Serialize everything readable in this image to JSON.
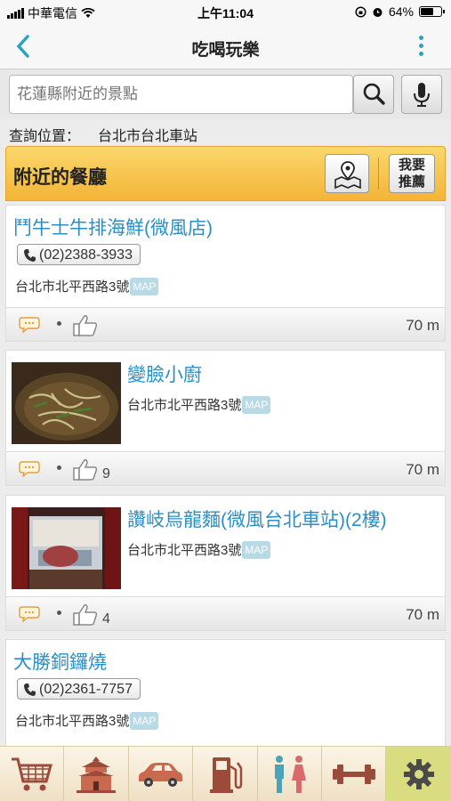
{
  "status": {
    "carrier": "中華電信",
    "time": "上午11:04",
    "battery": "64%",
    "battery_level": 0.64
  },
  "nav": {
    "title": "吃喝玩樂"
  },
  "search": {
    "placeholder": "花蓮縣附近的景點"
  },
  "location": {
    "label": "查詢位置：",
    "value": "台北市台北車站"
  },
  "section": {
    "title": "附近的餐廳",
    "recommend_line1": "我要",
    "recommend_line2": "推薦"
  },
  "restaurants": [
    {
      "name": "鬥牛士牛排海鮮(微風店)",
      "phone": "(02)2388-3933",
      "address": "台北市北平西路3號",
      "map": "MAP",
      "likes": "",
      "distance": "70 m"
    },
    {
      "name": "變臉小廚",
      "address": "台北市北平西路3號",
      "map": "MAP",
      "likes": "9",
      "distance": "70 m"
    },
    {
      "name": "讚岐烏龍麵(微風台北車站)(2樓)",
      "address": "台北市北平西路3號",
      "map": "MAP",
      "likes": "4",
      "distance": "70 m"
    },
    {
      "name": "大勝銅鑼燒",
      "phone": "(02)2361-7757",
      "address": "台北市北平西路3號",
      "map": "MAP"
    }
  ],
  "tabs": [
    "shopping-cart-icon",
    "temple-icon",
    "car-icon",
    "gas-pump-icon",
    "restroom-icon",
    "dumbbell-icon",
    "gear-icon"
  ]
}
